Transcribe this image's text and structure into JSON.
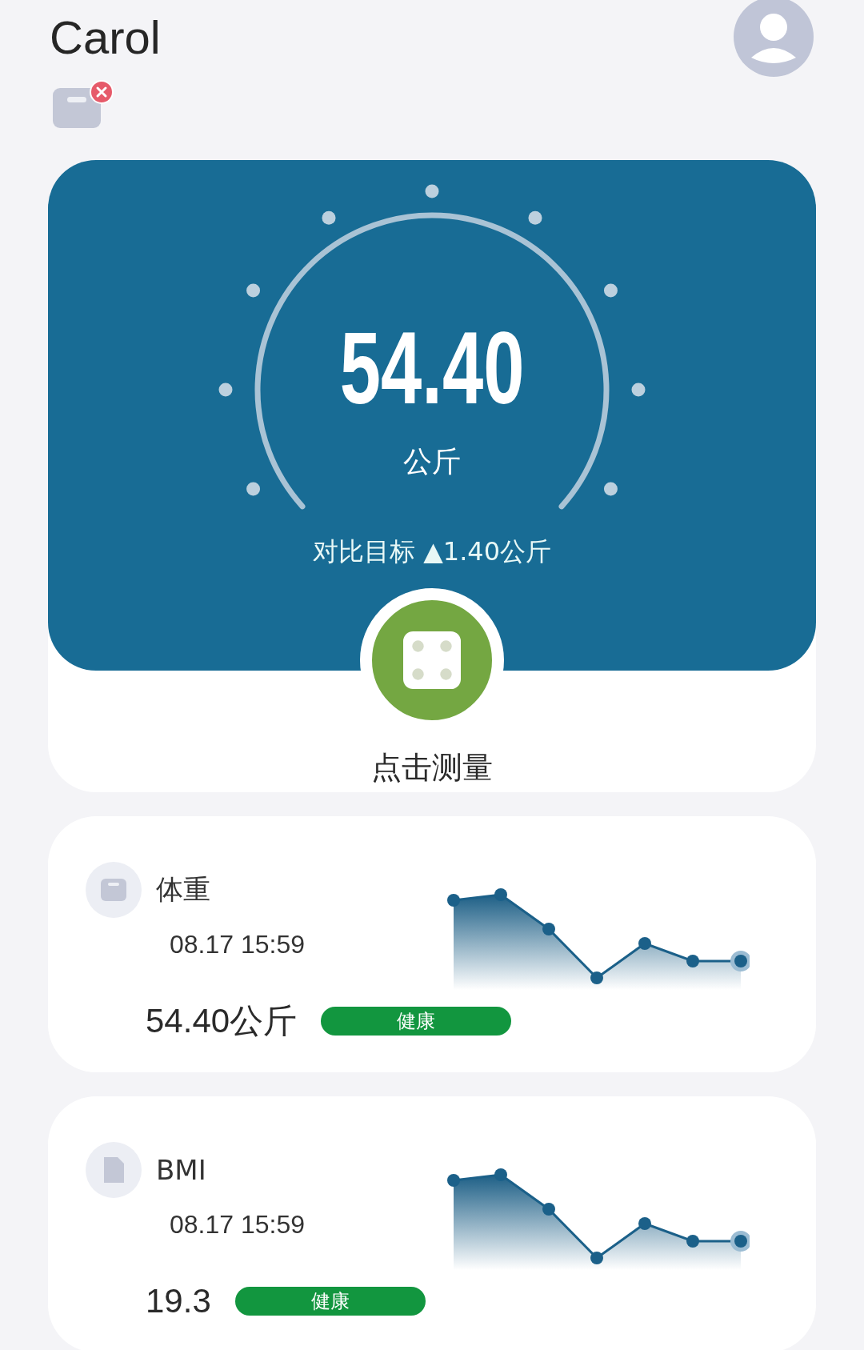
{
  "user": {
    "name": "Carol"
  },
  "device": {
    "connected": false
  },
  "weight_panel": {
    "value": "54.40",
    "unit": "公斤",
    "comparison": "对比目标 ▲1.40公斤"
  },
  "measure_button": {
    "label": "点击测量"
  },
  "metrics": [
    {
      "kind": "weight",
      "label": "体重",
      "time": "08.17 15:59",
      "value": "54.40公斤",
      "status": "健康"
    },
    {
      "kind": "bmi",
      "label": "BMI",
      "time": "08.17 15:59",
      "value": "19.3",
      "status": "健康"
    }
  ]
}
